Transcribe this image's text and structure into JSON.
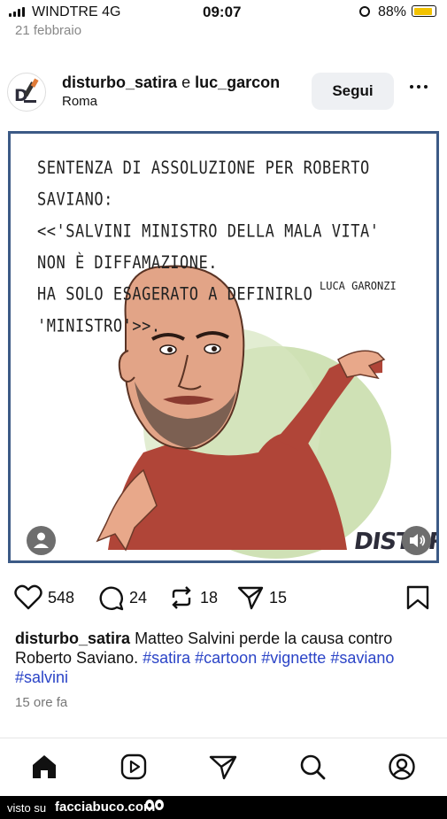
{
  "status_bar": {
    "carrier": "WINDTRE  4G",
    "time": "09:07",
    "battery": "88%",
    "battery_level": 0.88
  },
  "previous_post_date": "21 febbraio",
  "post": {
    "author": "disturbo_satira",
    "joiner": "e",
    "coauthor": "luc_garcon",
    "location": "Roma",
    "follow_label": "Segui",
    "image": {
      "lines": [
        "SENTENZA DI ASSOLUZIONE PER ROBERTO SAVIANO:",
        "<<'SALVINI MINISTRO DELLA MALA VITA'",
        "NON È DIFFAMAZIONE.",
        "HA SOLO ESAGERATO A DEFINIRLO 'MINISTRO'>>."
      ],
      "signature": "LUCA GARONZI",
      "brand": "DISTURBO"
    },
    "likes": "548",
    "comments": "24",
    "reposts": "18",
    "shares": "15",
    "caption_user": "disturbo_satira",
    "caption_text": "Matteo Salvini perde la causa contro Roberto Saviano.",
    "hashtags": [
      "#satira",
      "#cartoon",
      "#vignette",
      "#saviano",
      "#salvini"
    ],
    "time_ago": "15 ore fa"
  },
  "nav": {
    "icons": [
      "home-icon",
      "reels-icon",
      "send-icon",
      "search-icon",
      "profile-icon"
    ]
  },
  "footer": {
    "prefix": "visto su",
    "site": "facciabuco.com"
  }
}
